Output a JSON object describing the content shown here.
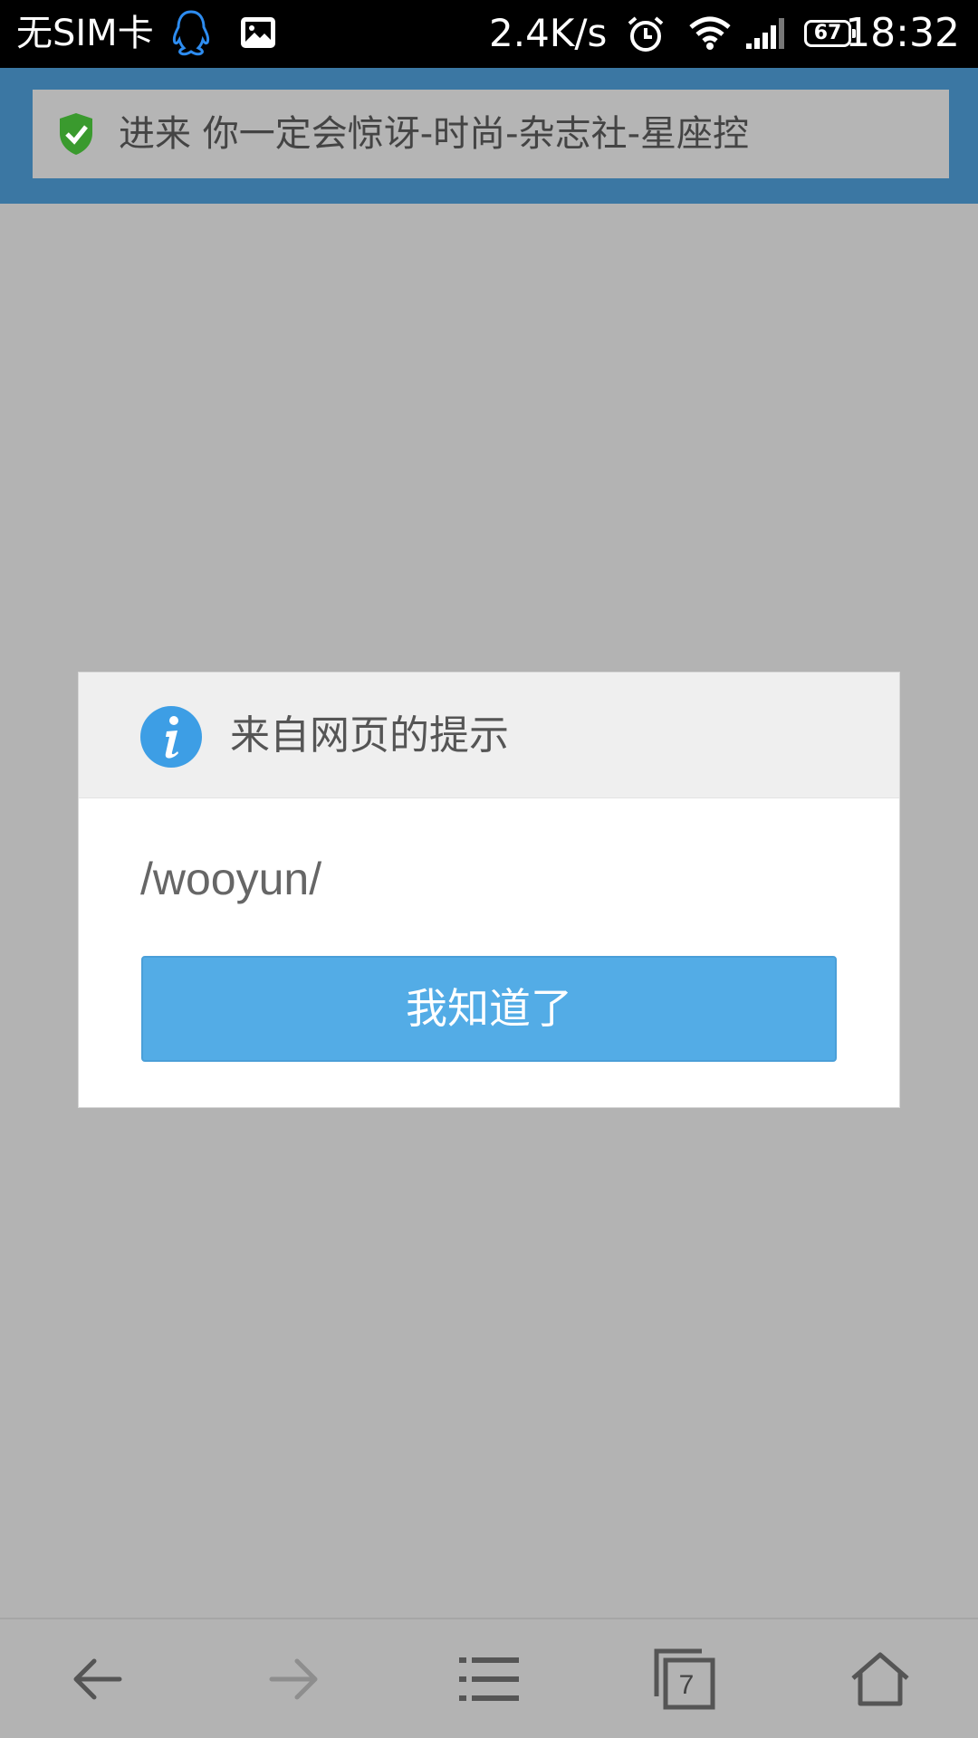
{
  "status_bar": {
    "carrier": "无SIM卡",
    "net_speed": "2.4K/s",
    "battery": "67",
    "time": "18:32",
    "icons": [
      "qq-icon",
      "image-icon",
      "alarm-icon",
      "wifi-icon",
      "signal-icon",
      "battery-icon"
    ]
  },
  "browser": {
    "page_title": "进来 你一定会惊讶-时尚-杂志社-星座控",
    "secure_icon": "shield-check-icon",
    "accent": "#3b77a3"
  },
  "dialog": {
    "title": "来自网页的提示",
    "icon": "info-icon",
    "message": "/wooyun/",
    "button_label": "我知道了",
    "button_color": "#53ace6"
  },
  "toolbar": {
    "items": [
      "back-icon",
      "forward-icon",
      "menu-icon",
      "tabs-icon",
      "home-icon"
    ],
    "tab_count": "7"
  }
}
